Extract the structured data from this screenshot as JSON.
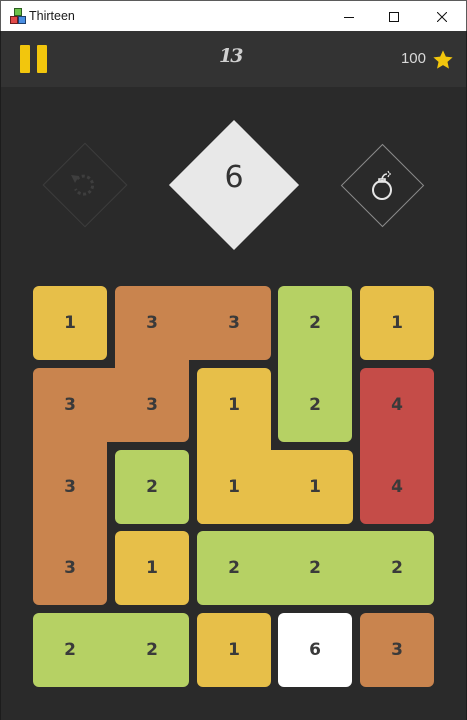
{
  "window": {
    "title": "Thirteen"
  },
  "header": {
    "logo": "13",
    "score": "100",
    "pause_icon": "pause-icon",
    "star_icon": "star-icon"
  },
  "powerups": {
    "next_value": "6",
    "undo_icon": "undo-icon",
    "bomb_icon": "bomb-icon"
  },
  "colors": {
    "one": "#e7bf49",
    "two": "#b6d164",
    "three": "#c9844e",
    "four": "#c54c48",
    "six": "#ffffff",
    "pause": "#f2c60d",
    "star": "#f2c60d"
  },
  "board": {
    "rows": [
      [
        "1",
        "3",
        "3",
        "2",
        "1"
      ],
      [
        "3",
        "3",
        "1",
        "2",
        "4"
      ],
      [
        "3",
        "2",
        "1",
        "1",
        "4"
      ],
      [
        "3",
        "1",
        "2",
        "2",
        "2"
      ],
      [
        "2",
        "2",
        "1",
        "6",
        "3"
      ]
    ]
  }
}
